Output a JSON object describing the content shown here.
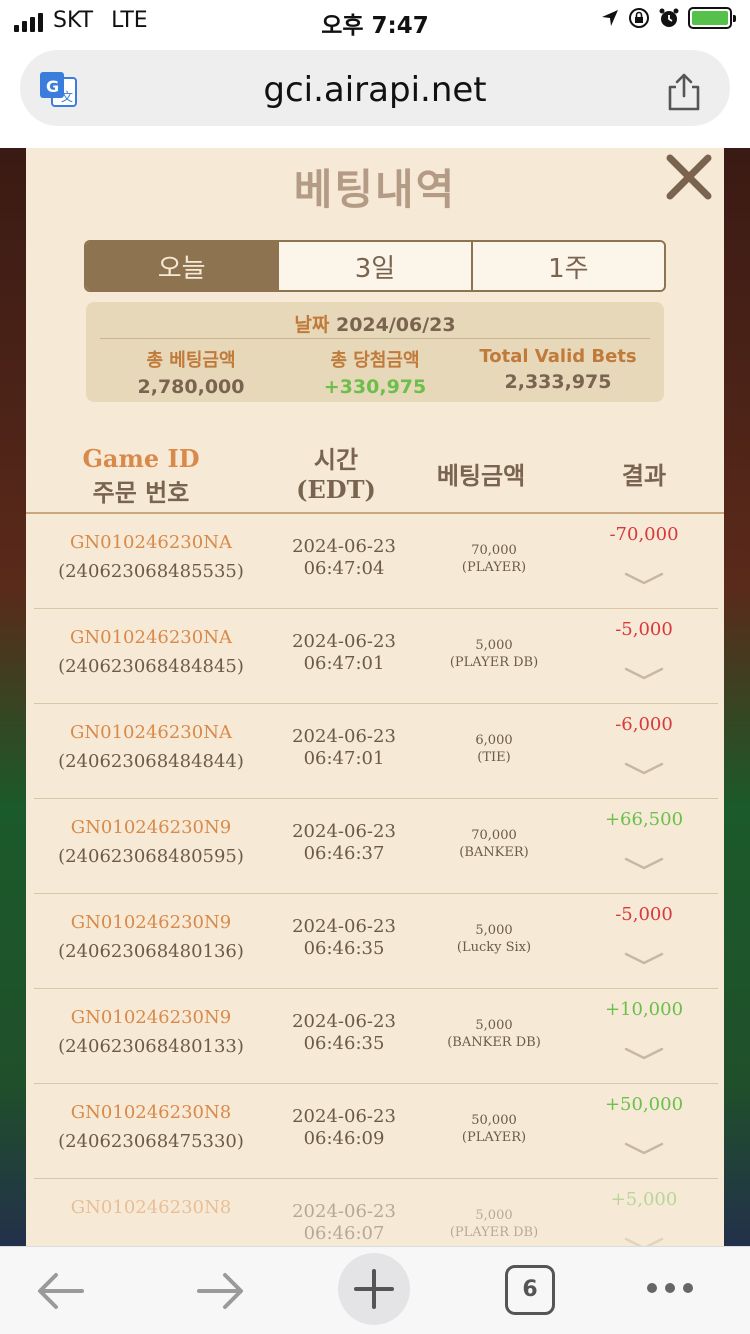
{
  "status_bar": {
    "carrier": "SKT",
    "network": "LTE",
    "time": "오후 7:47"
  },
  "browser": {
    "url": "gci.airapi.net",
    "open_tabs": "6"
  },
  "modal": {
    "title": "베팅내역",
    "tabs": [
      "오늘",
      "3일",
      "1주"
    ],
    "active_tab": "오늘",
    "summary": {
      "date_label": "날짜",
      "date_value": "2024/06/23",
      "total_bet_label": "총 베팅금액",
      "total_bet_value": "2,780,000",
      "total_win_label": "총 당첨금액",
      "total_win_value": "+330,975",
      "valid_bets_label": "Total Valid Bets",
      "valid_bets_value": "2,333,975"
    },
    "table": {
      "headers": {
        "game_id": "Game ID",
        "order_no": "주문 번호",
        "time": "시간",
        "time_zone": "(EDT)",
        "amount": "베팅금액",
        "result": "결과"
      },
      "rows": [
        {
          "game_id": "GN010246230NA",
          "order_no": "(240623068485535)",
          "date": "2024-06-23",
          "time": "06:47:04",
          "amount": "70,000",
          "bet": "(PLAYER)",
          "result": "-70,000",
          "type": "neg"
        },
        {
          "game_id": "GN010246230NA",
          "order_no": "(240623068484845)",
          "date": "2024-06-23",
          "time": "06:47:01",
          "amount": "5,000",
          "bet": "(PLAYER DB)",
          "result": "-5,000",
          "type": "neg"
        },
        {
          "game_id": "GN010246230NA",
          "order_no": "(240623068484844)",
          "date": "2024-06-23",
          "time": "06:47:01",
          "amount": "6,000",
          "bet": "(TIE)",
          "result": "-6,000",
          "type": "neg"
        },
        {
          "game_id": "GN010246230N9",
          "order_no": "(240623068480595)",
          "date": "2024-06-23",
          "time": "06:46:37",
          "amount": "70,000",
          "bet": "(BANKER)",
          "result": "+66,500",
          "type": "pos"
        },
        {
          "game_id": "GN010246230N9",
          "order_no": "(240623068480136)",
          "date": "2024-06-23",
          "time": "06:46:35",
          "amount": "5,000",
          "bet": "(Lucky Six)",
          "result": "-5,000",
          "type": "neg"
        },
        {
          "game_id": "GN010246230N9",
          "order_no": "(240623068480133)",
          "date": "2024-06-23",
          "time": "06:46:35",
          "amount": "5,000",
          "bet": "(BANKER DB)",
          "result": "+10,000",
          "type": "pos"
        },
        {
          "game_id": "GN010246230N8",
          "order_no": "(240623068475330)",
          "date": "2024-06-23",
          "time": "06:46:09",
          "amount": "50,000",
          "bet": "(PLAYER)",
          "result": "+50,000",
          "type": "pos"
        },
        {
          "game_id": "GN010246230N8",
          "order_no": "",
          "date": "2024-06-23",
          "time": "06:46:07",
          "amount": "5,000",
          "bet": "(PLAYER DB)",
          "result": "+5,000",
          "type": "pos"
        }
      ]
    }
  },
  "colors": {
    "modal_bg": "#f6ead7",
    "tab_active": "#8e7350",
    "accent_orange": "#d98a4a",
    "negative": "#d9383c",
    "positive": "#6bbf4a"
  }
}
